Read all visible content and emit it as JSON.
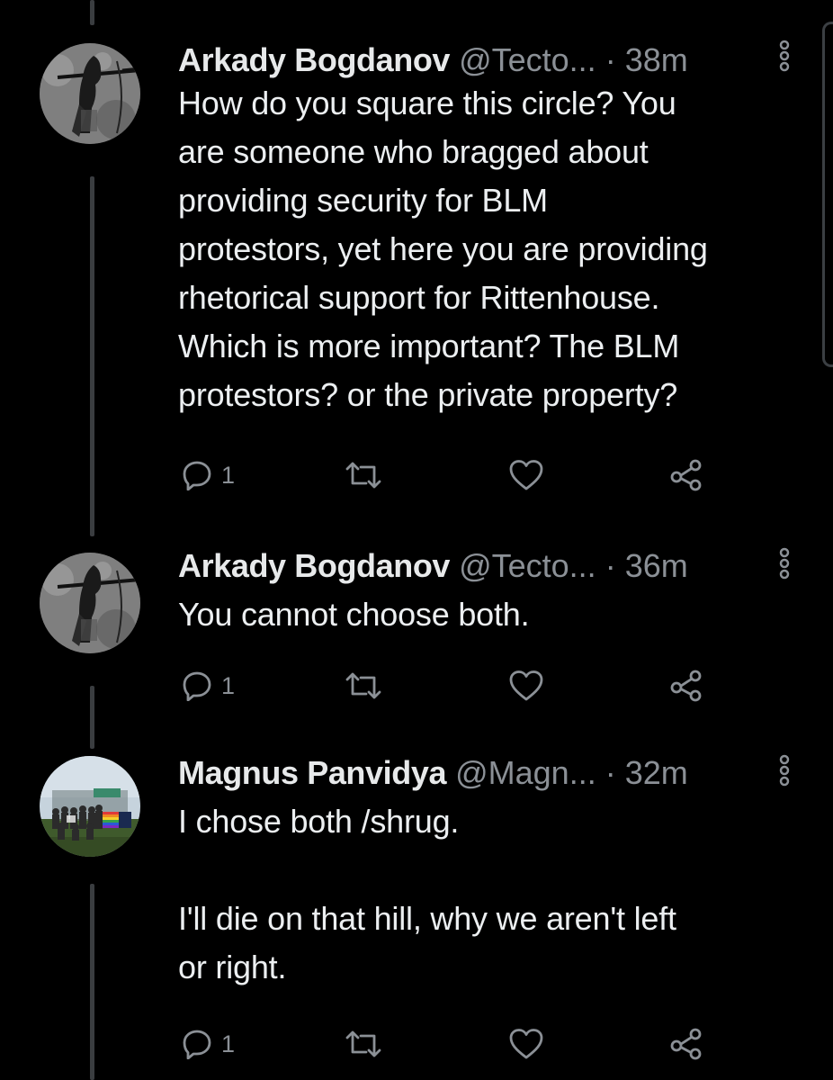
{
  "tweets": [
    {
      "name": "Arkady Bogdanov",
      "handle": "@Tecto...",
      "dot": "·",
      "time": "38m",
      "text": "How do you square this circle? You\nare someone who bragged about\nproviding security for BLM\nprotestors, yet here you are providing\nrhetorical support for Rittenhouse.\nWhich is more important? The BLM\nprotestors? or the private property?",
      "reply_count": "1"
    },
    {
      "name": "Arkady Bogdanov",
      "handle": "@Tecto...",
      "dot": "·",
      "time": "36m",
      "text": "You cannot choose both.",
      "reply_count": "1"
    },
    {
      "name": "Magnus Panvidya",
      "handle": "@Magn...",
      "dot": "·",
      "time": "32m",
      "text": "I chose both /shrug.\n\nI'll die on that hill, why we aren't left\nor right.",
      "reply_count": "1"
    }
  ],
  "icons": {
    "reply": "reply-icon",
    "retweet": "retweet-icon",
    "like": "heart-icon",
    "share": "share-icon",
    "more": "more-vertical-icon"
  },
  "colors": {
    "background": "#000000",
    "text": "#e7e9ea",
    "muted": "#8b9096",
    "thread_line": "#3a3d40"
  }
}
